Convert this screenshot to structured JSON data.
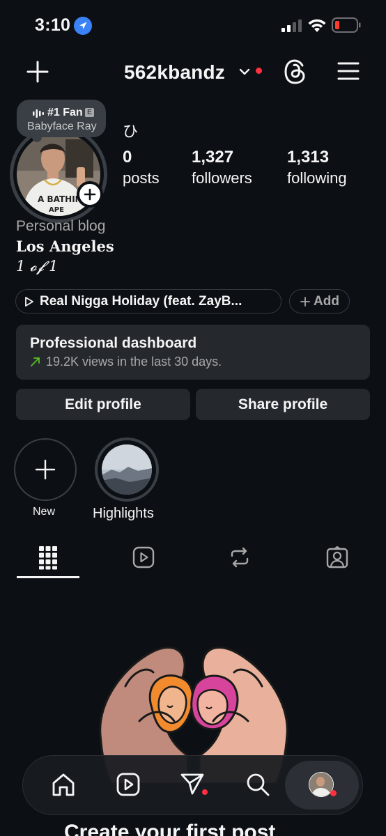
{
  "status_bar": {
    "time": "3:10",
    "location_icon": "location-arrow-icon",
    "battery_color": "#ff3b30"
  },
  "header": {
    "username": "562kbandz",
    "plus_icon": "plus-icon",
    "threads_icon": "threads-icon",
    "menu_icon": "hamburger-menu-icon"
  },
  "profile": {
    "fan_badge": {
      "title": "#1 Fan",
      "badge": "E",
      "artist": "Babyface Ray"
    },
    "display_name": "ひ",
    "stats": [
      {
        "value": "0",
        "label": "posts"
      },
      {
        "value": "1,327",
        "label": "followers"
      },
      {
        "value": "1,313",
        "label": "following"
      }
    ],
    "category": "Personal blog",
    "bio_line1": "Los Angeles",
    "bio_line2": "1 𝓸𝓯 1"
  },
  "music": {
    "track": "Real Nigga Holiday (feat. ZayB...",
    "add_label": "Add"
  },
  "dashboard": {
    "title": "Professional dashboard",
    "subtitle": "19.2K views in the last 30 days.",
    "trend_color": "#58c322"
  },
  "buttons": {
    "edit": "Edit profile",
    "share": "Share profile"
  },
  "highlights": [
    {
      "label": "New"
    },
    {
      "label": "Highlights"
    }
  ],
  "tabs": [
    "grid-icon",
    "reels-icon",
    "reposts-icon",
    "tagged-icon"
  ],
  "empty_state": {
    "title": "Create your first post"
  },
  "bottom_nav": [
    "home-icon",
    "reels-icon",
    "send-icon",
    "search-icon",
    "profile-avatar"
  ],
  "colors": {
    "background": "#0c1014",
    "surface": "#25292e",
    "notification": "#ff3040"
  }
}
